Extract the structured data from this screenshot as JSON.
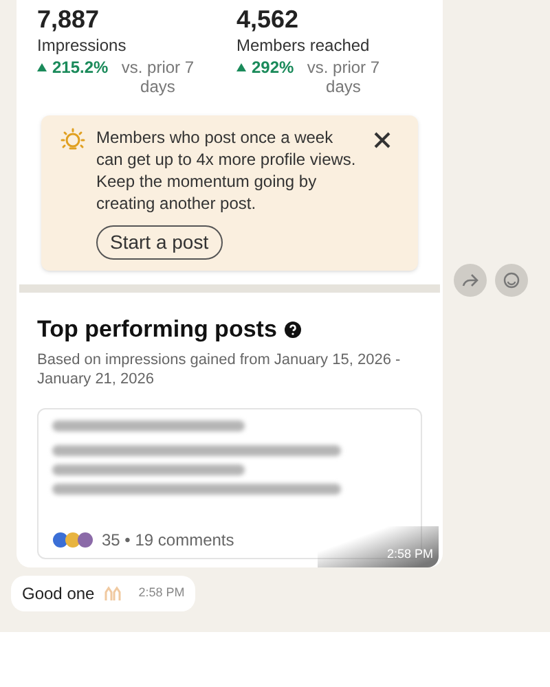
{
  "stats": [
    {
      "value": "7,887",
      "label": "Impressions",
      "change": "215.2%",
      "comparison": "vs. prior 7 days"
    },
    {
      "value": "4,562",
      "label": "Members reached",
      "change": "292%",
      "comparison": "vs. prior 7 days"
    }
  ],
  "tip": {
    "text": "Members who post once a week can get up to 4x more profile views. Keep the momentum going by creating another post.",
    "button": "Start a post"
  },
  "top_posts": {
    "title": "Top performing posts",
    "subtitle": "Based on impressions gained from January 15, 2026 - January 21, 2026",
    "post": {
      "engagement": "35 • 19 comments"
    }
  },
  "message_time": "2:58 PM",
  "reply": {
    "text": "Good one",
    "time": "2:58 PM"
  }
}
